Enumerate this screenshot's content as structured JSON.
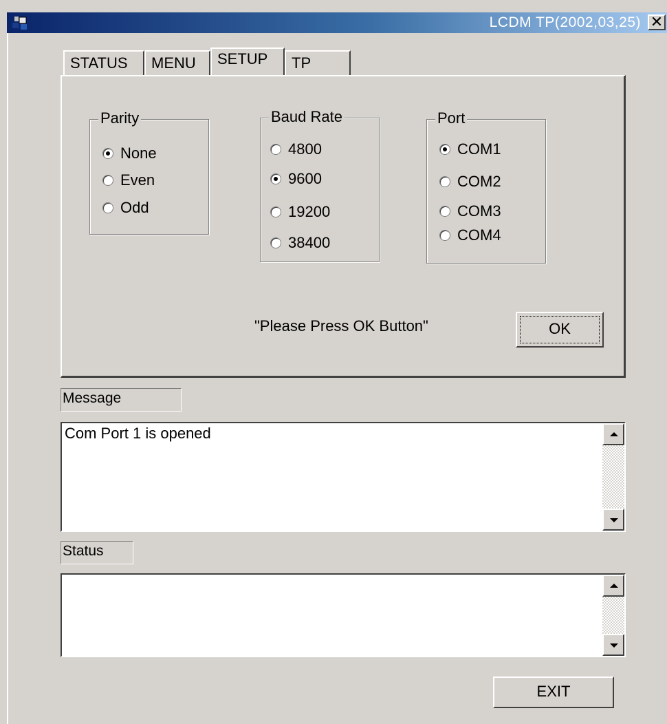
{
  "window": {
    "title": "LCDM TP(2002,03,25)",
    "close": "✕"
  },
  "tabs": [
    {
      "label": "STATUS"
    },
    {
      "label": "MENU"
    },
    {
      "label": "SETUP",
      "active": true
    },
    {
      "label": "TP"
    }
  ],
  "setup": {
    "parity": {
      "title": "Parity",
      "options": [
        {
          "label": "None",
          "checked": true
        },
        {
          "label": "Even",
          "checked": false
        },
        {
          "label": "Odd",
          "checked": false
        }
      ]
    },
    "baud_rate": {
      "title": "Baud Rate",
      "options": [
        {
          "label": "4800",
          "checked": false
        },
        {
          "label": "9600",
          "checked": true
        },
        {
          "label": "19200",
          "checked": false
        },
        {
          "label": "38400",
          "checked": false
        }
      ]
    },
    "port": {
      "title": "Port",
      "options": [
        {
          "label": "COM1",
          "checked": true
        },
        {
          "label": "COM2",
          "checked": false
        },
        {
          "label": "COM3",
          "checked": false
        },
        {
          "label": "COM4",
          "checked": false
        }
      ]
    },
    "prompt": "\"Please Press OK Button\"",
    "ok_label": "OK"
  },
  "message": {
    "label": "Message",
    "text": "Com Port 1 is opened"
  },
  "status": {
    "label": "Status",
    "text": ""
  },
  "exit_label": "EXIT"
}
